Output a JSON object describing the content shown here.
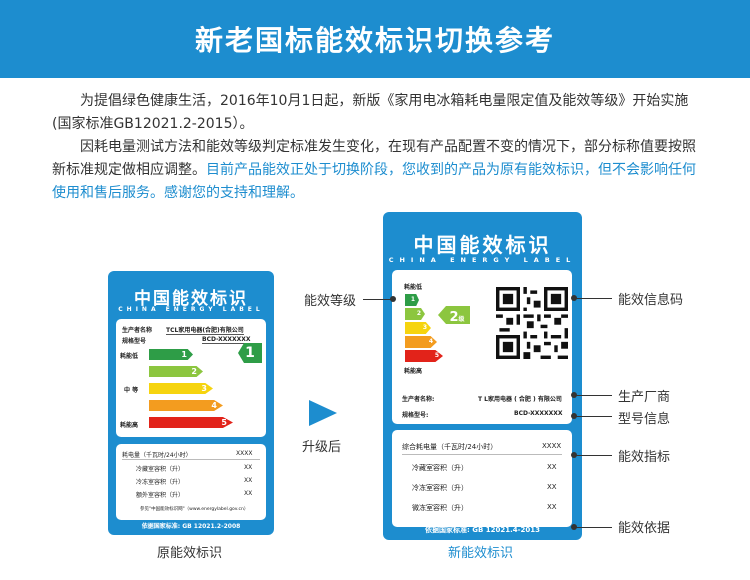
{
  "title": "新老国标能效标识切换参考",
  "intro": {
    "p1": "为提倡绿色健康生活，2016年10月1日起，新版《家用电冰箱耗电量限定值及能效等级》开始实施(国家标准GB12021.2-2015）。",
    "p2_plain": "因耗电量测试方法和能效等级判定标准发生变化，在现有产品配置不变的情况下，部分标称值要按照新标准规定做相应调整。",
    "p2_highlight": "目前产品能效正处于切换阶段，您收到的产品为原有能效标识，但不会影响任何使用和售后服务。感谢您的支持和理解。"
  },
  "old_label": {
    "brand_cn": "中国能效标识",
    "brand_en": "CHINA ENERGY LABEL",
    "manufacturer_key": "生产者名称",
    "manufacturer_val": "TCL家用电器(合肥)有限公司",
    "model_key": "规格型号",
    "model_val": "BCD-XXXXXXX",
    "low_label": "耗能低",
    "mid_label": "中 等",
    "high_label": "耗能高",
    "grades": [
      "1",
      "2",
      "3",
      "4",
      "5"
    ],
    "current_grade": "1",
    "rows": [
      {
        "k": "耗电量（千瓦时/24小时）",
        "v": "XXXX"
      },
      {
        "k": "冷藏室容积（升）",
        "v": "XX"
      },
      {
        "k": "冷冻室容积（升）",
        "v": "XX"
      },
      {
        "k": "额外室容积（升）",
        "v": "XX"
      }
    ],
    "footnote": "参见\"中国能效标识网\"（www.energylabel.gov.cn）",
    "standard": "依据国家标准: GB 12021.2-2008",
    "caption": "原能效标识"
  },
  "new_label": {
    "brand_cn": "中国能效标识",
    "brand_en": "CHINA ENERGY LABEL",
    "low_label": "耗能低",
    "high_label": "耗能高",
    "grades": [
      "1",
      "2",
      "3",
      "4",
      "5"
    ],
    "current_grade": "2",
    "current_grade_suffix": "级",
    "manufacturer_key": "生产者名称:",
    "manufacturer_val": "T L家用电器 ( 合肥 ) 有限公司",
    "model_key": "规格型号:",
    "model_val": "BCD-XXXXXXX",
    "rows": [
      {
        "k": "综合耗电量（千瓦时/24小时）",
        "v": "XXXX"
      },
      {
        "k": "冷藏室容积（升）",
        "v": "XX"
      },
      {
        "k": "冷冻室容积（升）",
        "v": "XX"
      },
      {
        "k": "微冻室容积（升）",
        "v": "XX"
      }
    ],
    "standard": "依据国家标准: GB 12021.4-2013",
    "caption": "新能效标识"
  },
  "upgrade_label": "升级后",
  "callouts": {
    "grade": "能效等级",
    "qr": "能效信息码",
    "manufacturer": "生产厂商",
    "model": "型号信息",
    "indicators": "能效指标",
    "basis": "能效依据"
  },
  "colors": {
    "brand_blue": "#1d8dcf",
    "grade1": "#2e9d47",
    "grade2": "#8cc63f",
    "grade3": "#f6d40f",
    "grade4": "#f39c1f",
    "grade5": "#e2231a"
  }
}
